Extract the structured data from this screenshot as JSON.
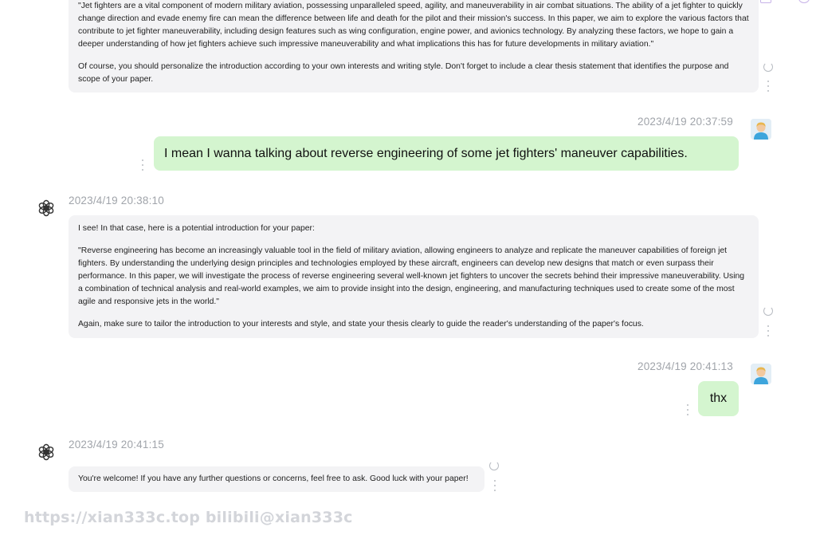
{
  "messages": {
    "ai_1": {
      "paragraphs": [
        "\"Jet fighters are a vital component of modern military aviation, possessing unparalleled speed, agility, and maneuverability in air combat situations. The ability of a jet fighter to quickly change direction and evade enemy fire can mean the difference between life and death for the pilot and their mission's success. In this paper, we aim to explore the various factors that contribute to jet fighter maneuverability, including design features such as wing configuration, engine power, and avionics technology. By analyzing these factors, we hope to gain a deeper understanding of how jet fighters achieve such impressive maneuverability and what implications this has for future developments in military aviation.\"",
        "Of course, you should personalize the introduction according to your own interests and writing style. Don't forget to include a clear thesis statement that identifies the purpose and scope of your paper."
      ]
    },
    "user_1": {
      "timestamp": "2023/4/19 20:37:59",
      "text": "I mean I wanna talking about reverse engineering of some jet fighters' maneuver capabilities."
    },
    "ai_2": {
      "timestamp": "2023/4/19 20:38:10",
      "paragraphs": [
        "I see! In that case, here is a potential introduction for your paper:",
        "\"Reverse engineering has become an increasingly valuable tool in the field of military aviation, allowing engineers to analyze and replicate the maneuver capabilities of foreign jet fighters. By understanding the underlying design principles and technologies employed by these aircraft, engineers can develop new designs that match or even surpass their performance. In this paper, we will investigate the process of reverse engineering several well-known jet fighters to uncover the secrets behind their impressive maneuverability. Using a combination of technical analysis and real-world examples, we aim to provide insight into the design, engineering, and manufacturing techniques used to create some of the most agile and responsive jets in the world.\"",
        "Again, make sure to tailor the introduction to your interests and style, and state your thesis clearly to guide the reader's understanding of the paper's focus."
      ]
    },
    "user_2": {
      "timestamp": "2023/4/19 20:41:13",
      "text": "thx"
    },
    "ai_3": {
      "timestamp": "2023/4/19 20:41:15",
      "paragraphs": [
        "You're welcome! If you have any further questions or concerns, feel free to ask. Good luck with your paper!"
      ]
    }
  },
  "icons": {
    "assistant_avatar": "openai-logo-icon",
    "user_avatar": "user-avatar",
    "regenerate": "refresh-icon",
    "more": "more-vertical-icon"
  },
  "watermark": "https://xian333c.top bilibili@xian333c",
  "colors": {
    "ai_bubble": "#f3f3f5",
    "user_bubble": "#d4f5cf",
    "timestamp": "#a0a4aa"
  }
}
